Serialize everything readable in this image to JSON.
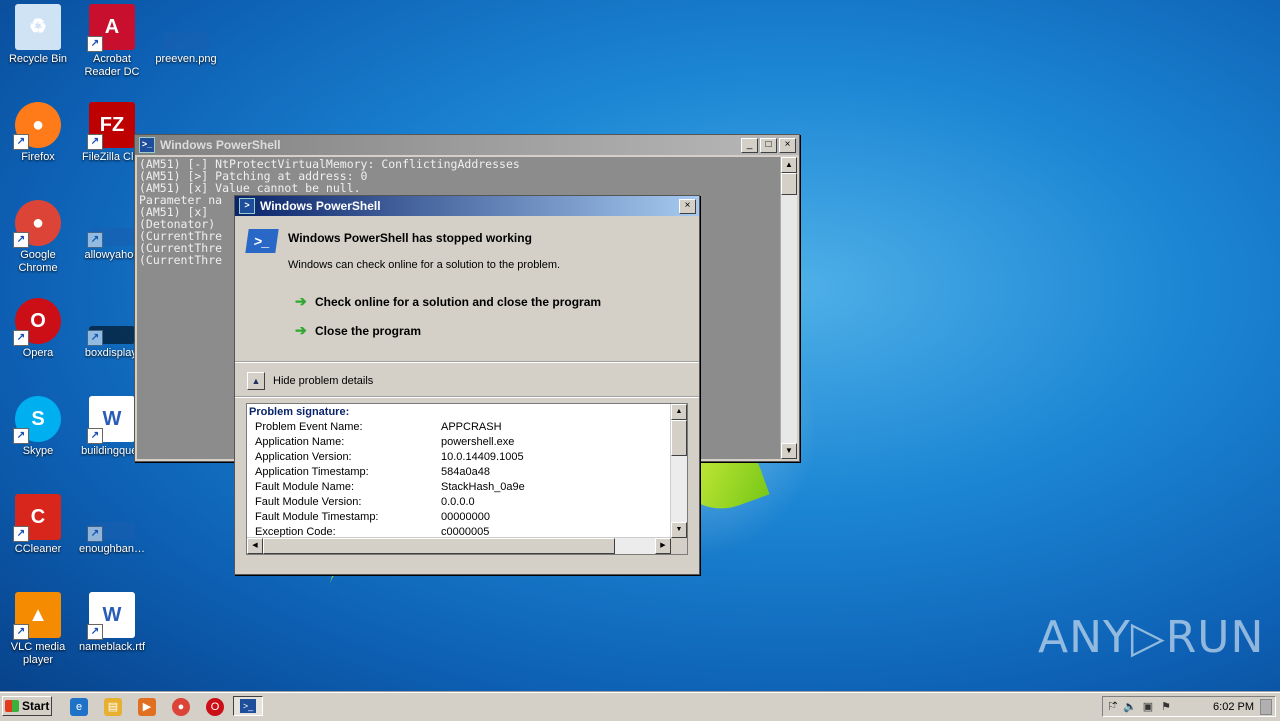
{
  "desktop": {
    "icons": [
      {
        "label": "Recycle Bin",
        "glyph": "♻",
        "color": "#cfe3f5"
      },
      {
        "label": "Acrobat Reader DC",
        "glyph": "A",
        "color": "#c8102e"
      },
      {
        "label": "preeven.png",
        "glyph": "",
        "color": "#1a5fb0"
      },
      {
        "label": "Firefox",
        "glyph": "●",
        "color": "#ff7a18"
      },
      {
        "label": "FileZilla Clie",
        "glyph": "FZ",
        "color": "#bf0000"
      },
      {
        "label": "Google Chrome",
        "glyph": "●",
        "color": "#db4437"
      },
      {
        "label": "allowyahoo",
        "glyph": "",
        "color": "#1a5fb0"
      },
      {
        "label": "Opera",
        "glyph": "O",
        "color": "#cc0f16"
      },
      {
        "label": "boxdisplay.",
        "glyph": "",
        "color": "#000000"
      },
      {
        "label": "Skype",
        "glyph": "S",
        "color": "#00aff0"
      },
      {
        "label": "buildingques",
        "glyph": "W",
        "color": "#ffffff"
      },
      {
        "label": "CCleaner",
        "glyph": "C",
        "color": "#d8261c"
      },
      {
        "label": "enoughban…",
        "glyph": "",
        "color": "#1a5fb0"
      },
      {
        "label": "VLC media player",
        "glyph": "▲",
        "color": "#f48b00"
      },
      {
        "label": "nameblack.rtf",
        "glyph": "W",
        "color": "#ffffff"
      }
    ]
  },
  "powershell_window": {
    "title": "Windows PowerShell",
    "console_lines": [
      "(AM51) [-] NtProtectVirtualMemory: ConflictingAddresses",
      "(AM51) [>] Patching at address: 0",
      "(AM51) [x] Value cannot be null.",
      "Parameter na",
      "(AM51) [x]",
      "(Detonator)",
      "(CurrentThre",
      "(CurrentThre",
      "(CurrentThre"
    ],
    "buttons": {
      "minimize": "_",
      "maximize": "□",
      "close": "×"
    }
  },
  "error_dialog": {
    "title": "Windows PowerShell",
    "heading": "Windows PowerShell has stopped working",
    "subtext": "Windows can check online for a solution to the problem.",
    "option_check": "Check online for a solution and close the program",
    "option_close": "Close the program",
    "details_toggle": "Hide problem details",
    "close_button": "×",
    "problem_signature_title": "Problem signature:",
    "signature_rows": [
      {
        "key": "Problem Event Name:",
        "value": "APPCRASH"
      },
      {
        "key": "Application Name:",
        "value": "powershell.exe"
      },
      {
        "key": "Application Version:",
        "value": "10.0.14409.1005"
      },
      {
        "key": "Application Timestamp:",
        "value": "584a0a48"
      },
      {
        "key": "Fault Module Name:",
        "value": "StackHash_0a9e"
      },
      {
        "key": "Fault Module Version:",
        "value": "0.0.0.0"
      },
      {
        "key": "Fault Module Timestamp:",
        "value": "00000000"
      },
      {
        "key": "Exception Code:",
        "value": "c0000005"
      }
    ]
  },
  "taskbar": {
    "start_label": "Start",
    "quick_launch": [
      {
        "name": "ie-icon",
        "glyph": "e",
        "color": "#1e73c8"
      },
      {
        "name": "explorer-icon",
        "glyph": "▤",
        "color": "#e8b030"
      },
      {
        "name": "media-player-icon",
        "glyph": "▶",
        "color": "#e07020"
      },
      {
        "name": "chrome-icon",
        "glyph": "●",
        "color": "#db4437"
      },
      {
        "name": "opera-icon",
        "glyph": "O",
        "color": "#cc0f16"
      }
    ],
    "clock": "6:02 PM"
  },
  "watermark": "ANY▷RUN"
}
